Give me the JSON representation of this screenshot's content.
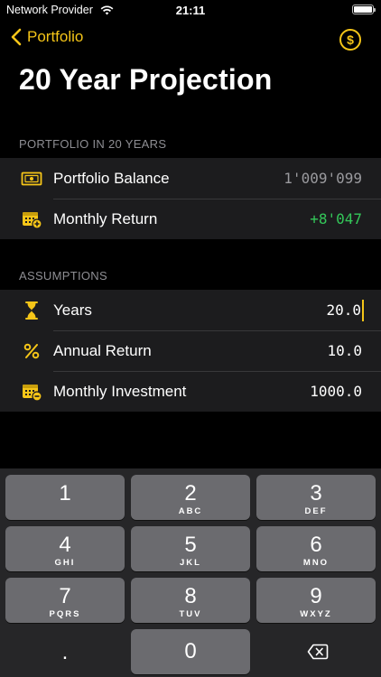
{
  "status": {
    "carrier": "Network Provider",
    "time": "21:11"
  },
  "nav": {
    "back_label": "Portfolio",
    "dollar_symbol": "$"
  },
  "title": "20 Year Projection",
  "portfolio_section": {
    "header": "PORTFOLIO IN 20 YEARS",
    "rows": [
      {
        "label": "Portfolio Balance",
        "value": "1'009'099",
        "icon": "banknote-icon"
      },
      {
        "label": "Monthly Return",
        "value": "+8'047",
        "icon": "calendar-plus-icon"
      }
    ]
  },
  "assumptions_section": {
    "header": "ASSUMPTIONS",
    "rows": [
      {
        "label": "Years",
        "value": "20.0",
        "icon": "hourglass-icon"
      },
      {
        "label": "Annual Return",
        "value": "10.0",
        "icon": "percent-icon"
      },
      {
        "label": "Monthly Investment",
        "value": "1000.0",
        "icon": "calendar-minus-icon"
      }
    ]
  },
  "keyboard": {
    "keys": [
      {
        "num": "1",
        "letters": ""
      },
      {
        "num": "2",
        "letters": "ABC"
      },
      {
        "num": "3",
        "letters": "DEF"
      },
      {
        "num": "4",
        "letters": "GHI"
      },
      {
        "num": "5",
        "letters": "JKL"
      },
      {
        "num": "6",
        "letters": "MNO"
      },
      {
        "num": "7",
        "letters": "PQRS"
      },
      {
        "num": "8",
        "letters": "TUV"
      },
      {
        "num": "9",
        "letters": "WXYZ"
      },
      {
        "num": ".",
        "letters": ""
      },
      {
        "num": "0",
        "letters": ""
      }
    ]
  },
  "colors": {
    "accent": "#f5c518",
    "positive": "#34c759",
    "background": "#000000",
    "cell": "#1c1c1e"
  }
}
